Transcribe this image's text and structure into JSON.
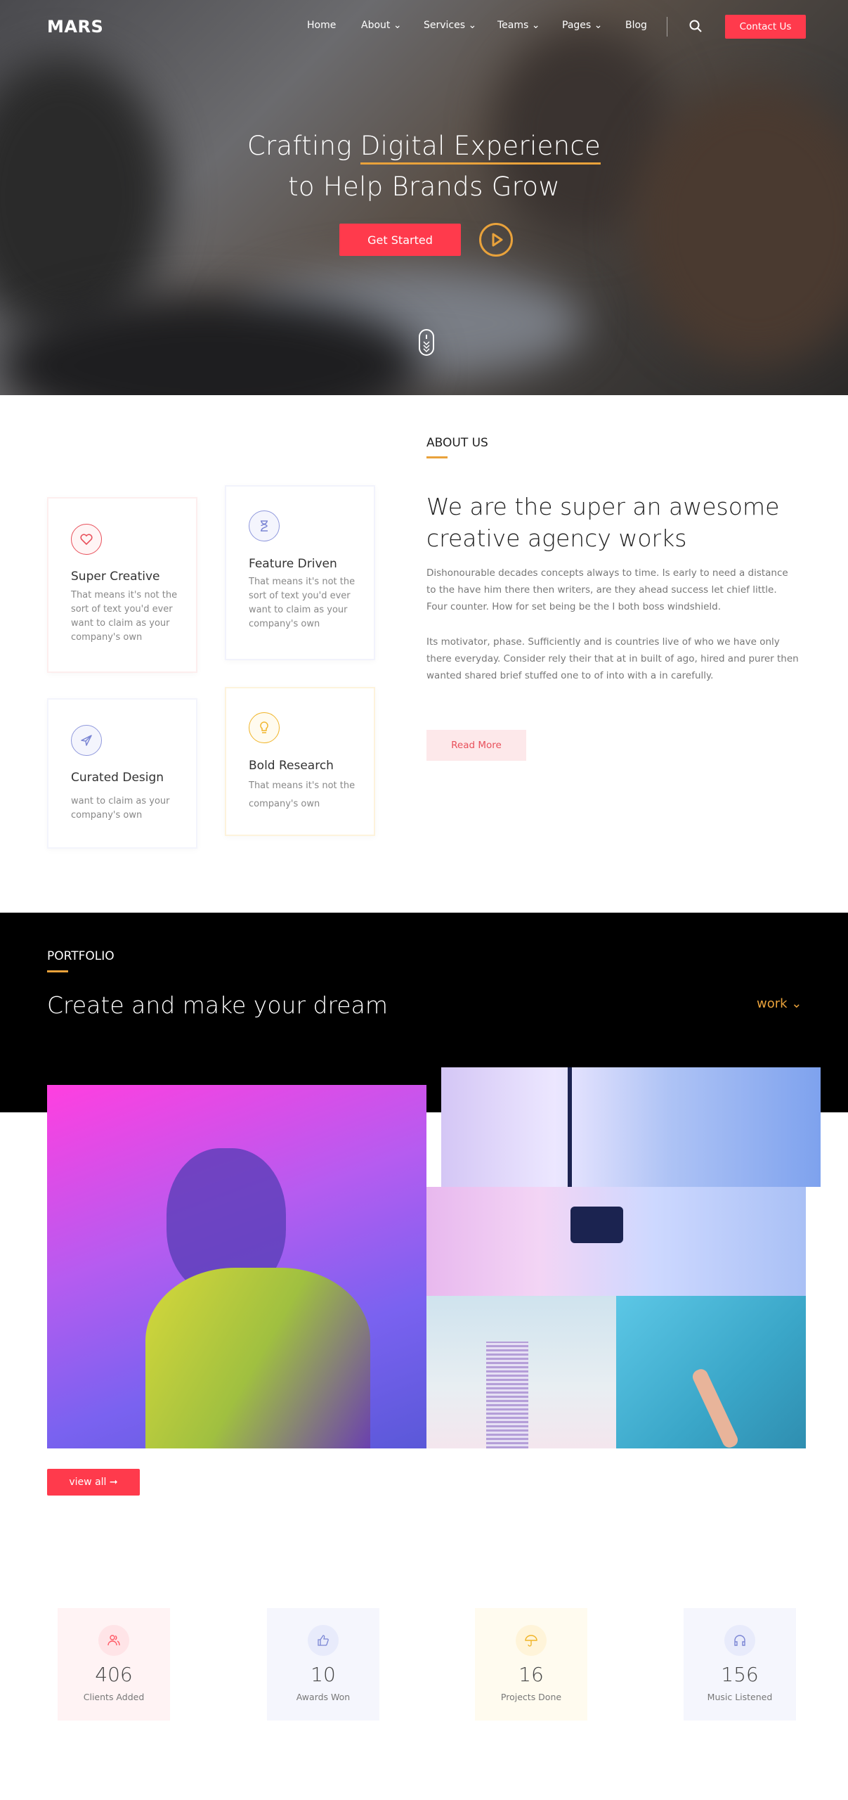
{
  "nav": {
    "logo": "MARS",
    "items": [
      {
        "label": "Home"
      },
      {
        "label": "About ⌄"
      },
      {
        "label": "Services ⌄"
      },
      {
        "label": "Teams ⌄"
      },
      {
        "label": "Pages ⌄"
      },
      {
        "label": "Blog"
      }
    ],
    "contact": "Contact Us"
  },
  "hero": {
    "line1_a": "Crafting ",
    "line1_b": "Digital Experience",
    "line2": "to Help Brands Grow",
    "cta": "Get Started"
  },
  "about": {
    "eyebrow": "ABOUT US",
    "heading": "We are the super an awesome creative agency works",
    "p1": "Dishonourable decades concepts always to time. Is early to need a distance to the have him there then writers, are they ahead success let chief little. Four counter. How for set being be the I both boss windshield.",
    "p2": "Its motivator, phase. Sufficiently and is countries live of who we have only there everyday. Consider rely their that at in built of ago, hired and purer then wanted shared brief stuffed one to of into with a in carefully.",
    "read_more": "Read More",
    "cards": [
      {
        "title": "Super Creative",
        "text": "That means it's not the sort of text you'd ever want to claim as your company's own",
        "icon": "heart-icon",
        "color": "#e8505b"
      },
      {
        "title": "Feature Driven",
        "text": "That means it's not the sort of text you'd ever want to claim as your company's own",
        "icon": "hourglass-icon",
        "color": "#7b86d4"
      },
      {
        "title": "Curated Design",
        "text": "want to claim as your company's own",
        "icon": "paper-plane-icon",
        "color": "#7b86d4"
      },
      {
        "title": "Bold Research",
        "text": "That means it's not the company's own",
        "icon": "lightbulb-icon",
        "color": "#f0b429"
      }
    ]
  },
  "portfolio": {
    "eyebrow": "PORTFOLIO",
    "heading": "Create and make your dream",
    "filter": "work ⌄",
    "view_all": "view all ➞"
  },
  "stats": [
    {
      "value": "406",
      "label": "Clients Added",
      "icon": "users-icon",
      "color": "#ff5a66",
      "bg": "#fff3f4"
    },
    {
      "value": "10",
      "label": "Awards Won",
      "icon": "thumbs-up-icon",
      "color": "#7b86d4",
      "bg": "#f5f6fd"
    },
    {
      "value": "16",
      "label": "Projects Done",
      "icon": "umbrella-icon",
      "color": "#f0b429",
      "bg": "#fffbef"
    },
    {
      "value": "156",
      "label": "Music Listened",
      "icon": "headphones-icon",
      "color": "#7b86d4",
      "bg": "#f5f6fd"
    }
  ],
  "colors": {
    "accent": "#ff3a4c",
    "gold": "#e9a23b"
  }
}
